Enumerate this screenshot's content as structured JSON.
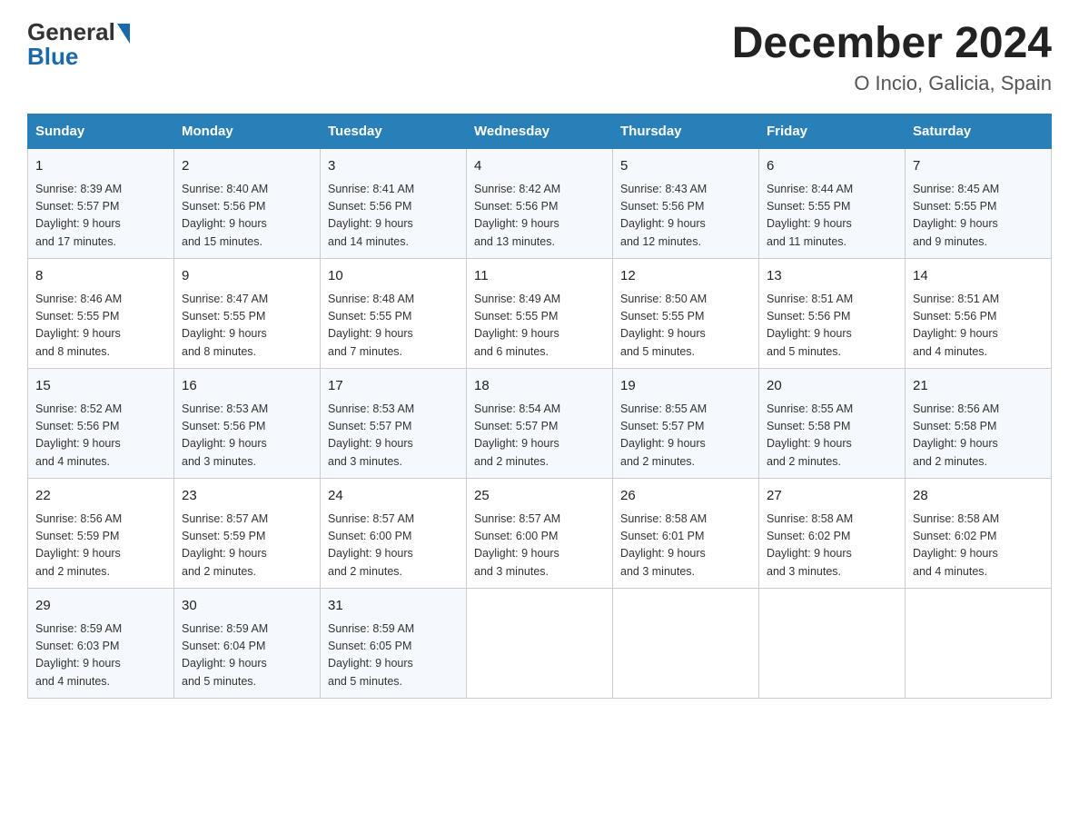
{
  "header": {
    "logo_general": "General",
    "logo_blue": "Blue",
    "month_year": "December 2024",
    "location": "O Incio, Galicia, Spain"
  },
  "days_of_week": [
    "Sunday",
    "Monday",
    "Tuesday",
    "Wednesday",
    "Thursday",
    "Friday",
    "Saturday"
  ],
  "weeks": [
    [
      {
        "day": "1",
        "sunrise": "8:39 AM",
        "sunset": "5:57 PM",
        "daylight": "9 hours and 17 minutes."
      },
      {
        "day": "2",
        "sunrise": "8:40 AM",
        "sunset": "5:56 PM",
        "daylight": "9 hours and 15 minutes."
      },
      {
        "day": "3",
        "sunrise": "8:41 AM",
        "sunset": "5:56 PM",
        "daylight": "9 hours and 14 minutes."
      },
      {
        "day": "4",
        "sunrise": "8:42 AM",
        "sunset": "5:56 PM",
        "daylight": "9 hours and 13 minutes."
      },
      {
        "day": "5",
        "sunrise": "8:43 AM",
        "sunset": "5:56 PM",
        "daylight": "9 hours and 12 minutes."
      },
      {
        "day": "6",
        "sunrise": "8:44 AM",
        "sunset": "5:55 PM",
        "daylight": "9 hours and 11 minutes."
      },
      {
        "day": "7",
        "sunrise": "8:45 AM",
        "sunset": "5:55 PM",
        "daylight": "9 hours and 9 minutes."
      }
    ],
    [
      {
        "day": "8",
        "sunrise": "8:46 AM",
        "sunset": "5:55 PM",
        "daylight": "9 hours and 8 minutes."
      },
      {
        "day": "9",
        "sunrise": "8:47 AM",
        "sunset": "5:55 PM",
        "daylight": "9 hours and 8 minutes."
      },
      {
        "day": "10",
        "sunrise": "8:48 AM",
        "sunset": "5:55 PM",
        "daylight": "9 hours and 7 minutes."
      },
      {
        "day": "11",
        "sunrise": "8:49 AM",
        "sunset": "5:55 PM",
        "daylight": "9 hours and 6 minutes."
      },
      {
        "day": "12",
        "sunrise": "8:50 AM",
        "sunset": "5:55 PM",
        "daylight": "9 hours and 5 minutes."
      },
      {
        "day": "13",
        "sunrise": "8:51 AM",
        "sunset": "5:56 PM",
        "daylight": "9 hours and 5 minutes."
      },
      {
        "day": "14",
        "sunrise": "8:51 AM",
        "sunset": "5:56 PM",
        "daylight": "9 hours and 4 minutes."
      }
    ],
    [
      {
        "day": "15",
        "sunrise": "8:52 AM",
        "sunset": "5:56 PM",
        "daylight": "9 hours and 4 minutes."
      },
      {
        "day": "16",
        "sunrise": "8:53 AM",
        "sunset": "5:56 PM",
        "daylight": "9 hours and 3 minutes."
      },
      {
        "day": "17",
        "sunrise": "8:53 AM",
        "sunset": "5:57 PM",
        "daylight": "9 hours and 3 minutes."
      },
      {
        "day": "18",
        "sunrise": "8:54 AM",
        "sunset": "5:57 PM",
        "daylight": "9 hours and 2 minutes."
      },
      {
        "day": "19",
        "sunrise": "8:55 AM",
        "sunset": "5:57 PM",
        "daylight": "9 hours and 2 minutes."
      },
      {
        "day": "20",
        "sunrise": "8:55 AM",
        "sunset": "5:58 PM",
        "daylight": "9 hours and 2 minutes."
      },
      {
        "day": "21",
        "sunrise": "8:56 AM",
        "sunset": "5:58 PM",
        "daylight": "9 hours and 2 minutes."
      }
    ],
    [
      {
        "day": "22",
        "sunrise": "8:56 AM",
        "sunset": "5:59 PM",
        "daylight": "9 hours and 2 minutes."
      },
      {
        "day": "23",
        "sunrise": "8:57 AM",
        "sunset": "5:59 PM",
        "daylight": "9 hours and 2 minutes."
      },
      {
        "day": "24",
        "sunrise": "8:57 AM",
        "sunset": "6:00 PM",
        "daylight": "9 hours and 2 minutes."
      },
      {
        "day": "25",
        "sunrise": "8:57 AM",
        "sunset": "6:00 PM",
        "daylight": "9 hours and 3 minutes."
      },
      {
        "day": "26",
        "sunrise": "8:58 AM",
        "sunset": "6:01 PM",
        "daylight": "9 hours and 3 minutes."
      },
      {
        "day": "27",
        "sunrise": "8:58 AM",
        "sunset": "6:02 PM",
        "daylight": "9 hours and 3 minutes."
      },
      {
        "day": "28",
        "sunrise": "8:58 AM",
        "sunset": "6:02 PM",
        "daylight": "9 hours and 4 minutes."
      }
    ],
    [
      {
        "day": "29",
        "sunrise": "8:59 AM",
        "sunset": "6:03 PM",
        "daylight": "9 hours and 4 minutes."
      },
      {
        "day": "30",
        "sunrise": "8:59 AM",
        "sunset": "6:04 PM",
        "daylight": "9 hours and 5 minutes."
      },
      {
        "day": "31",
        "sunrise": "8:59 AM",
        "sunset": "6:05 PM",
        "daylight": "9 hours and 5 minutes."
      },
      null,
      null,
      null,
      null
    ]
  ],
  "labels": {
    "sunrise": "Sunrise:",
    "sunset": "Sunset:",
    "daylight": "Daylight:"
  }
}
